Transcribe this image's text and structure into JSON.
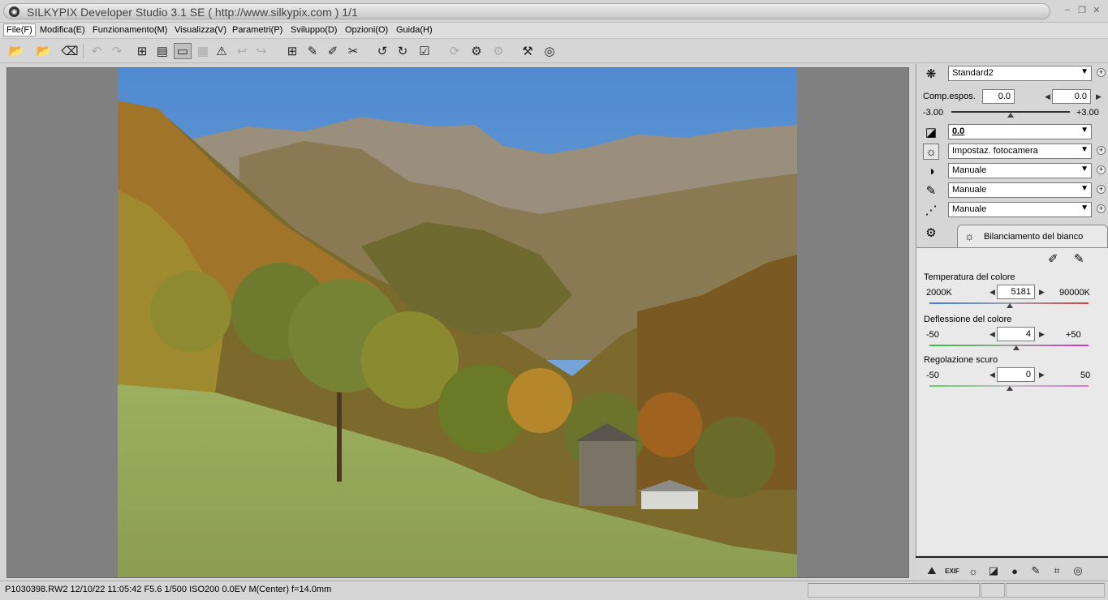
{
  "window": {
    "title": "SILKYPIX Developer Studio 3.1 SE ( http://www.silkypix.com )   1/1",
    "buttons": [
      "–",
      "❐",
      "✕"
    ]
  },
  "menu": [
    {
      "label": "File(F)"
    },
    {
      "label": "Modifica(E)"
    },
    {
      "label": "Funzionamento(M)"
    },
    {
      "label": "Visualizza(V)"
    },
    {
      "label": "Parametri(P)"
    },
    {
      "label": "Sviluppo(D)"
    },
    {
      "label": "Opzioni(O)"
    },
    {
      "label": "Guida(H)"
    }
  ],
  "toolbar": {
    "icons": [
      "open-folder-icon",
      "open-file-icon",
      "erase-icon",
      "undo-icon",
      "redo-icon",
      "grid-view-icon",
      "list-view-icon",
      "single-view-icon",
      "compare-view-icon",
      "warning-icon",
      "back-icon",
      "forward-icon",
      "crop-icon",
      "tone-pick-icon",
      "color-pick-icon",
      "pipette-icon",
      "rotate-left-icon",
      "rotate-right-icon",
      "check-icon",
      "refresh-icon",
      "batch-develop-icon",
      "develop-icon",
      "hammer-icon",
      "help-icon"
    ]
  },
  "panel": {
    "taste": {
      "value": "Standard2"
    },
    "exposure": {
      "label": "Comp.espos.",
      "value1": "0.0",
      "value2": "0.0",
      "min": "-3.00",
      "max": "+3.00",
      "level": 0.5
    },
    "tone": {
      "value": "0.0"
    },
    "white_balance_select": {
      "value": "Impostaz. fotocamera"
    },
    "contrast": {
      "value": "Manuale"
    },
    "sharpness": {
      "value": "Manuale"
    },
    "noise": {
      "value": "Manuale"
    },
    "tab_label": "Bilanciamento del bianco",
    "wb": {
      "temperature": {
        "label": "Temperatura del colore",
        "min": "2000K",
        "max": "90000K",
        "value": "5181",
        "level": 0.5
      },
      "deflection": {
        "label": "Deflessione del colore",
        "min": "-50",
        "max": "+50",
        "value": "4",
        "level": 0.54
      },
      "dark": {
        "label": "Regolazione scuro",
        "min": "-50",
        "max": "50",
        "value": "0",
        "level": 0.5
      }
    }
  },
  "status": {
    "text": "P1030398.RW2 12/10/22 11:05:42 F5.6 1/500 ISO200  0.0EV M(Center) f=14.0mm"
  },
  "colors": {
    "sky": "#5b93cf",
    "grass": "#8fa55a"
  }
}
